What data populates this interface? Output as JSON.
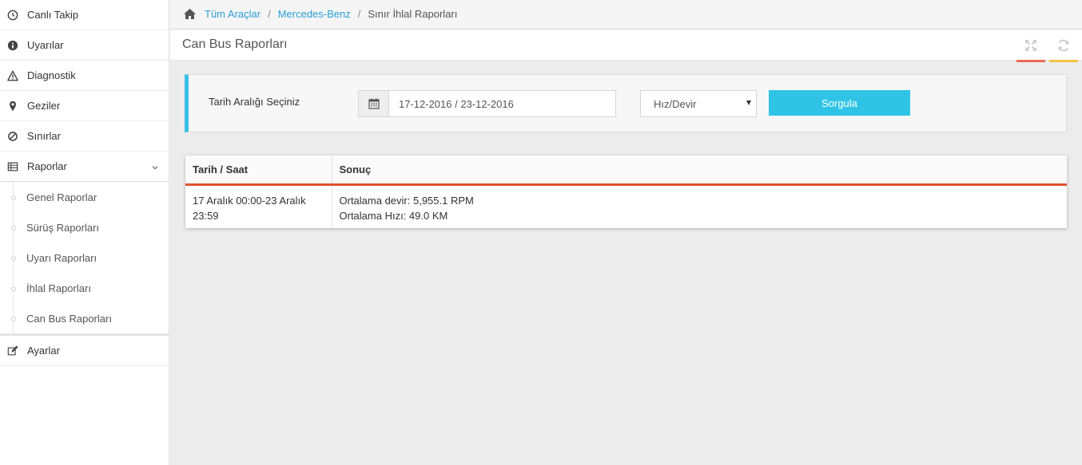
{
  "sidebar": {
    "items": [
      {
        "label": "Canlı Takip",
        "icon": "clock-icon"
      },
      {
        "label": "Uyarılar",
        "icon": "info-icon"
      },
      {
        "label": "Diagnostik",
        "icon": "warning-icon"
      },
      {
        "label": "Geziler",
        "icon": "map-marker-icon"
      },
      {
        "label": "Sınırlar",
        "icon": "ban-icon"
      },
      {
        "label": "Raporlar",
        "icon": "table-icon"
      }
    ],
    "sub_items": [
      {
        "label": "Genel Raporlar"
      },
      {
        "label": "Sürüş Raporları"
      },
      {
        "label": "Uyarı Raporları"
      },
      {
        "label": "İhlal Raporları"
      },
      {
        "label": "Can Bus Raporları"
      }
    ],
    "settings": {
      "label": "Ayarlar",
      "icon": "edit-icon"
    }
  },
  "breadcrumb": {
    "home_icon": "home-icon",
    "items": [
      "Tüm Araçlar",
      "Mercedes-Benz",
      "Sınır İhlal Raporları"
    ],
    "separator": "/"
  },
  "page": {
    "title": "Can Bus Raporları",
    "tools": [
      "expand-icon",
      "refresh-icon"
    ]
  },
  "filter": {
    "label": "Tarih Aralığı Seçiniz",
    "date_value": "17-12-2016 / 23-12-2016",
    "select_value": "Hız/Devir",
    "submit_label": "Sorgula"
  },
  "table": {
    "headers": [
      "Tarih / Saat",
      "Sonuç"
    ],
    "rows": [
      {
        "date_line1": "17 Aralık 00:00-23 Aralık",
        "date_line2": "23:59",
        "result_line1": "Ortalama devir: 5,955.1 RPM",
        "result_line2": "Ortalama Hızı: 49.0 KM"
      }
    ]
  },
  "colors": {
    "accent_blue": "#2fc4e6",
    "link_blue": "#2a9fd6",
    "table_header_underline": "#e0532f",
    "tool_red": "#e96a58",
    "tool_yellow": "#f6c24a"
  }
}
